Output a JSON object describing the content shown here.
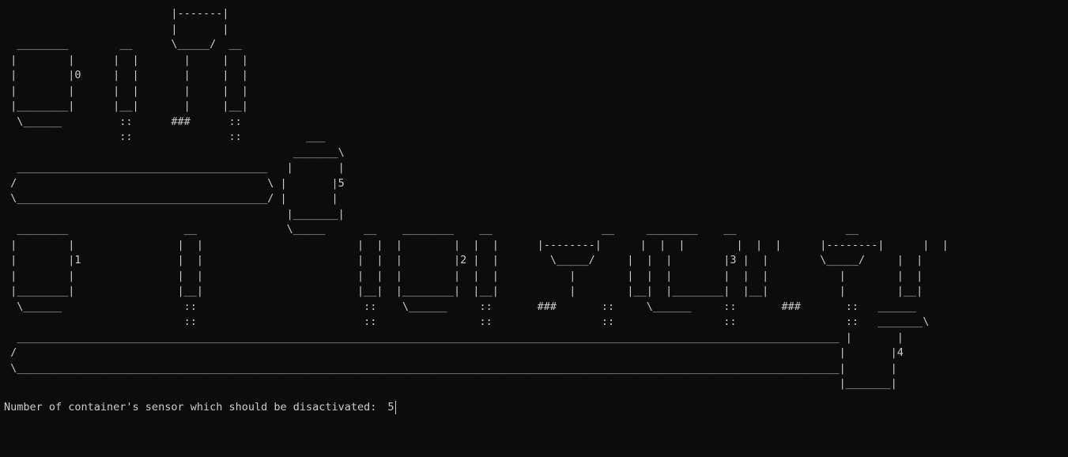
{
  "terminal": {
    "art": "                          |-------|\n                          |       |\n  ________        __      \\_____/  __\n |        |      |  |       |     |  |\n |        |0     |  |       |     |  |\n |        |      |  |       |     |  |\n |________|      |__|       |     |__|\n  \\______         ::      ###      ::\n                  ::               ::          ___\n                                             _______\\\n  _______________________________________   |       |\n /                                       \\ |       |5\n \\_______________________________________/ |       |\n                                            |_______|\n  ________                  __              \\_____      __    ________    __                 __     ________    __                 __\n |        |                |  |                        |  |  |        |  |  |      |--------|      |  |  |        |  |  |      |--------|      |  |\n |        |1               |  |                        |  |  |        |2 |  |        \\_____/     |  |  |        |3 |  |        \\_____/     |  |\n |        |                |  |                        |  |  |        |  |  |           |        |  |  |        |  |  |           |        |  |\n |________|                |__|                        |__|  |________|  |__|           |        |__|  |________|  |__|           |        |__|\n  \\______                   ::                          ::    \\______     ::       ###       ::     \\______     ::       ###       ::   ______\n                            ::                          ::                ::                 ::                 ::                 ::   _______\\\n  ________________________________________________________________________________________________________________________________ |       |\n /                                                                                                                                |       |4\n \\________________________________________________________________________________________________________________________________|       |\n                                                                                                                                  |_______|",
    "prompt": "Number of container's sensor which should be disactivated:",
    "input_value": "5"
  }
}
